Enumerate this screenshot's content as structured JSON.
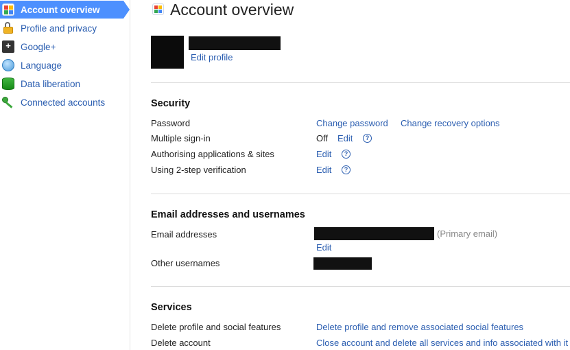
{
  "sidebar": {
    "items": [
      {
        "label": "Account overview",
        "icon": "google-icon",
        "active": true
      },
      {
        "label": "Profile and privacy",
        "icon": "lock-icon"
      },
      {
        "label": "Google+",
        "icon": "google-plus-icon"
      },
      {
        "label": "Language",
        "icon": "language-icon"
      },
      {
        "label": "Data liberation",
        "icon": "database-icon"
      },
      {
        "label": "Connected accounts",
        "icon": "key-icon"
      }
    ]
  },
  "header": {
    "title": "Account overview"
  },
  "profile": {
    "edit_label": "Edit profile"
  },
  "security": {
    "title": "Security",
    "password": {
      "label": "Password",
      "change_password": "Change password",
      "change_recovery": "Change recovery options"
    },
    "multiple_signin": {
      "label": "Multiple sign-in",
      "status": "Off",
      "edit": "Edit"
    },
    "authorising": {
      "label": "Authorising applications & sites",
      "edit": "Edit"
    },
    "two_step": {
      "label": "Using 2-step verification",
      "edit": "Edit"
    }
  },
  "emails": {
    "title": "Email addresses and usernames",
    "email_label": "Email addresses",
    "primary_note": "(Primary email)",
    "edit": "Edit",
    "other_label": "Other usernames"
  },
  "services": {
    "title": "Services",
    "delete_profile": {
      "label": "Delete profile and social features",
      "link": "Delete profile and remove associated social features"
    },
    "delete_account": {
      "label": "Delete account",
      "link": "Close account and delete all services and info associated with it"
    }
  },
  "colors": {
    "accent": "#4d90fe",
    "link": "#2a5db0",
    "divider": "#dcdcdc"
  }
}
